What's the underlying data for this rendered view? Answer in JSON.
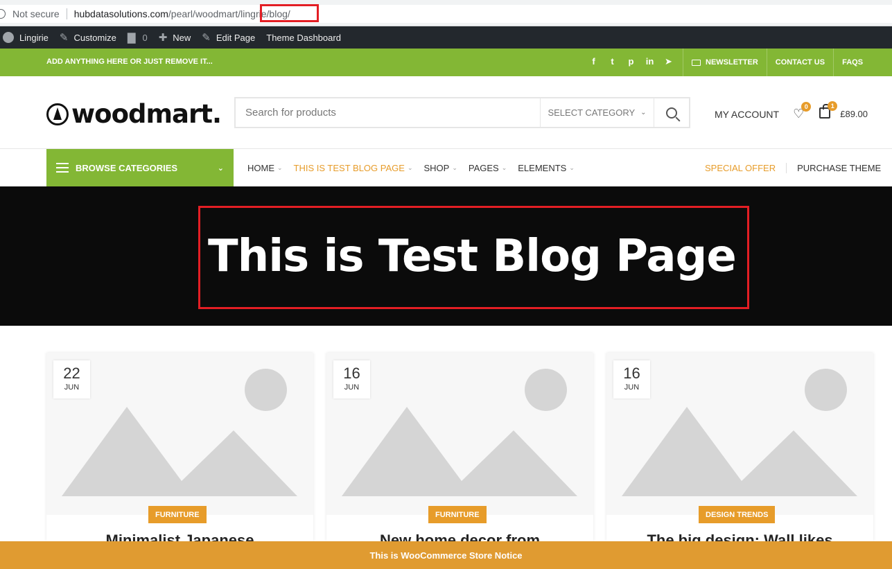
{
  "browser": {
    "security": "Not secure",
    "url_main": "hubdatasolutions.com",
    "url_path": "/pearl/woodmart/lingrie/blog/"
  },
  "wp_admin_bar": {
    "site": "Lingirie",
    "customize": "Customize",
    "comments_count": "0",
    "new": "New",
    "edit_page": "Edit Page",
    "theme_dashboard": "Theme Dashboard"
  },
  "topbar": {
    "promo": "ADD ANYTHING HERE OR JUST REMOVE IT...",
    "social_icons": [
      "facebook-icon",
      "twitter-icon",
      "pinterest-icon",
      "linkedin-icon",
      "telegram-icon"
    ],
    "newsletter": "NEWSLETTER",
    "contact": "CONTACT US",
    "faqs": "FAQS"
  },
  "header": {
    "logo": "woodmart.",
    "search_placeholder": "Search for products",
    "category": "SELECT CATEGORY",
    "account": "MY ACCOUNT",
    "wishlist_count": "0",
    "cart_count": "1",
    "cart_total": "£89.00"
  },
  "nav": {
    "browse": "BROWSE CATEGORIES",
    "items": [
      {
        "label": "HOME"
      },
      {
        "label": "THIS IS TEST BLOG PAGE"
      },
      {
        "label": "SHOP"
      },
      {
        "label": "PAGES"
      },
      {
        "label": "ELEMENTS"
      }
    ],
    "special": "SPECIAL OFFER",
    "purchase": "PURCHASE THEME"
  },
  "hero": {
    "title": "This is Test Blog Page"
  },
  "posts": [
    {
      "day": "22",
      "month": "JUN",
      "category": "FURNITURE",
      "title": "Minimalist Japanese"
    },
    {
      "day": "16",
      "month": "JUN",
      "category": "FURNITURE",
      "title": "New home decor from"
    },
    {
      "day": "16",
      "month": "JUN",
      "category": "DESIGN TRENDS",
      "title": "The big design: Wall likes"
    }
  ],
  "notice": "This is WooCommerce Store Notice",
  "colors": {
    "green": "#83b735",
    "orange": "#e79c2a",
    "highlight_red": "#e31e24",
    "hero_bg": "#0b0b0b"
  }
}
